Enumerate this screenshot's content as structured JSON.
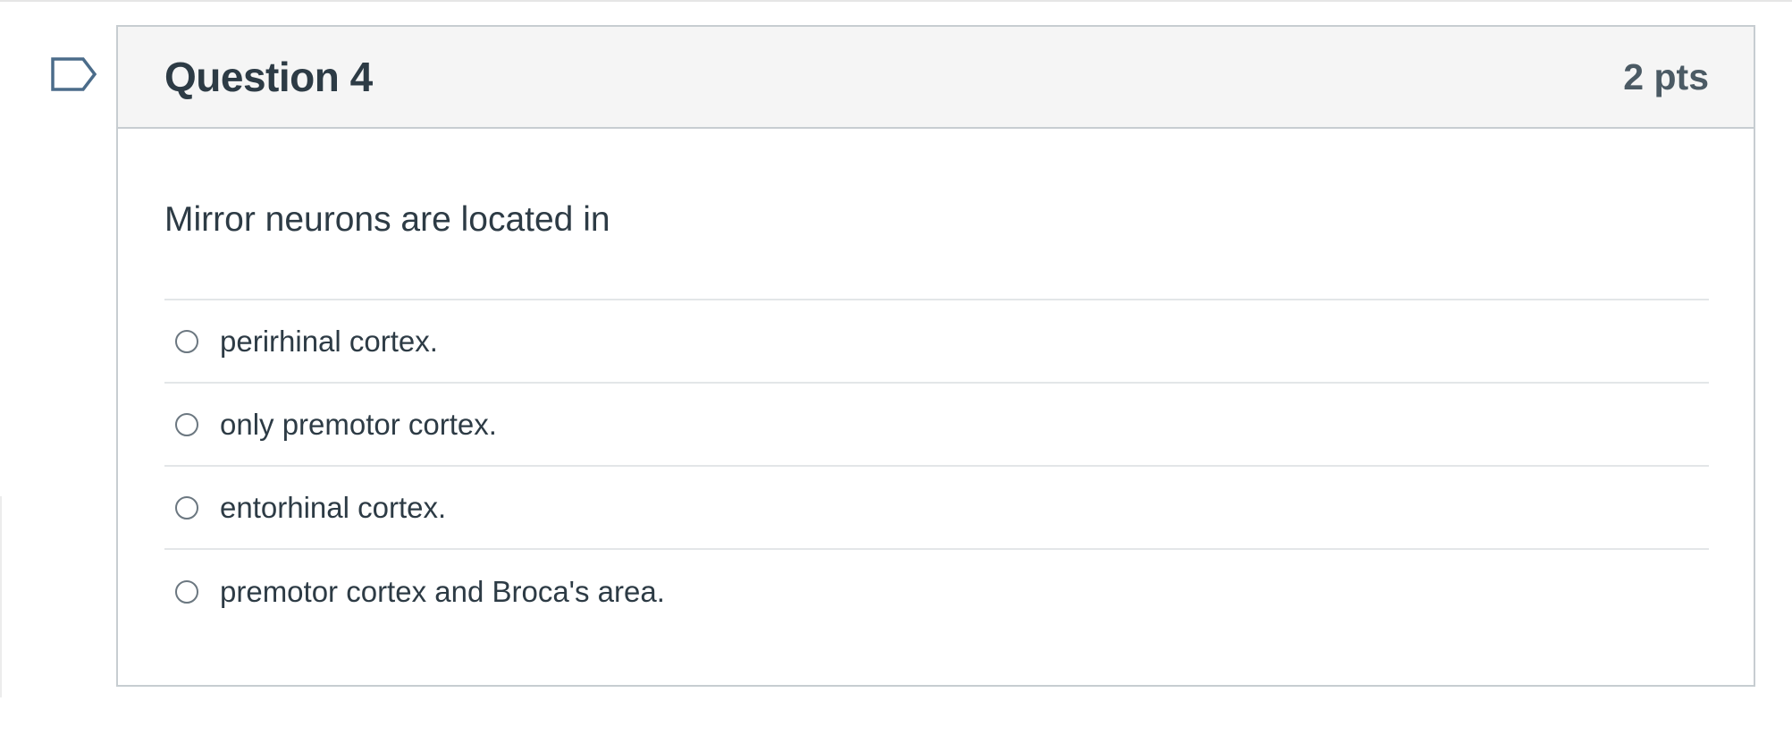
{
  "question": {
    "title": "Question 4",
    "points": "2 pts",
    "text": "Mirror neurons are located in",
    "flag_icon": "flag-outline-icon"
  },
  "answers": [
    {
      "label": "perirhinal cortex.",
      "selected": false
    },
    {
      "label": "only premotor cortex.",
      "selected": false
    },
    {
      "label": "entorhinal cortex.",
      "selected": false
    },
    {
      "label": "premotor cortex and Broca's area.",
      "selected": false
    }
  ],
  "colors": {
    "text": "#2d3b45",
    "points_text": "#4b5a64",
    "header_bg": "#f5f5f5",
    "border": "#c7cdd1",
    "divider": "#e3e6e8"
  }
}
